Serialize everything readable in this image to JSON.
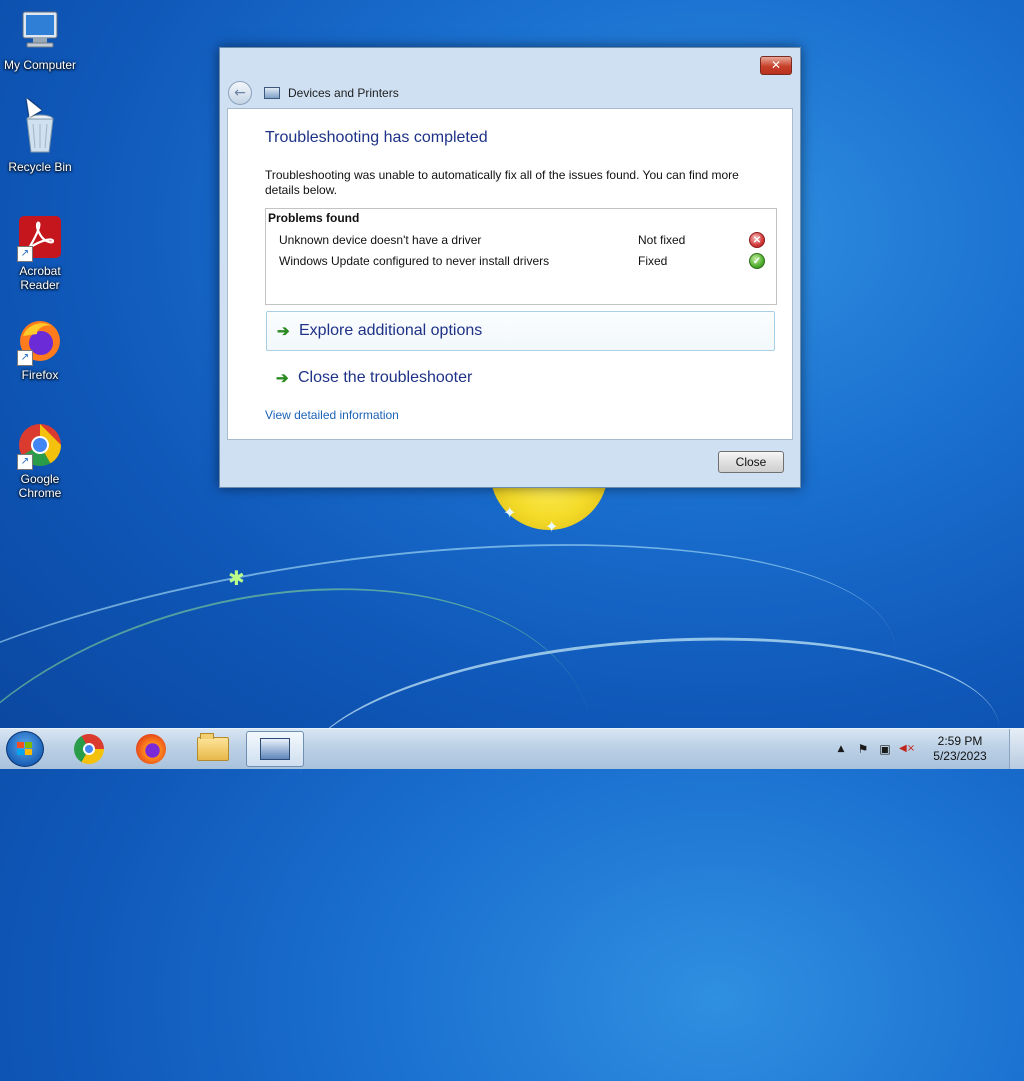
{
  "desktop_icons": [
    {
      "label": "My Computer",
      "icon": "computer-icon"
    },
    {
      "label": "Recycle Bin",
      "icon": "recycle-bin-icon"
    },
    {
      "label": "Acrobat Reader",
      "icon": "acrobat-icon"
    },
    {
      "label": "Firefox",
      "icon": "firefox-icon"
    },
    {
      "label": "Google Chrome",
      "icon": "chrome-icon"
    }
  ],
  "dialog": {
    "close_glyph": "✕",
    "back_glyph": "←",
    "location": "Devices and Printers",
    "heading": "Troubleshooting has completed",
    "description": "Troubleshooting was unable to automatically fix all of the issues found. You can find more details below.",
    "problems_header": "Problems found",
    "problems": [
      {
        "name": "Unknown device doesn't have a driver",
        "status": "Not fixed",
        "status_icon": "error-icon",
        "glyph": "✕"
      },
      {
        "name": "Windows Update configured to never install drivers",
        "status": "Fixed",
        "status_icon": "check-icon",
        "glyph": "✓"
      }
    ],
    "options": [
      {
        "label": "Explore additional options",
        "arrow": "➔"
      },
      {
        "label": "Close the troubleshooter",
        "arrow": "➔"
      }
    ],
    "detail_link": "View detailed information",
    "close_button": "Close"
  },
  "taskbar": {
    "apps": [
      "chrome-icon",
      "firefox-icon",
      "explorer-icon",
      "devices-and-printers-icon"
    ],
    "tray": {
      "show_hidden": "▲",
      "action_center": "⚑",
      "network": "▣",
      "volume": "◀×"
    },
    "time": "2:59 PM",
    "date": "5/23/2023"
  },
  "colors": {
    "heading": "#1e3287",
    "link": "#1c63b8",
    "fixed": "#4fae2c",
    "not_fixed": "#d23a3a"
  }
}
